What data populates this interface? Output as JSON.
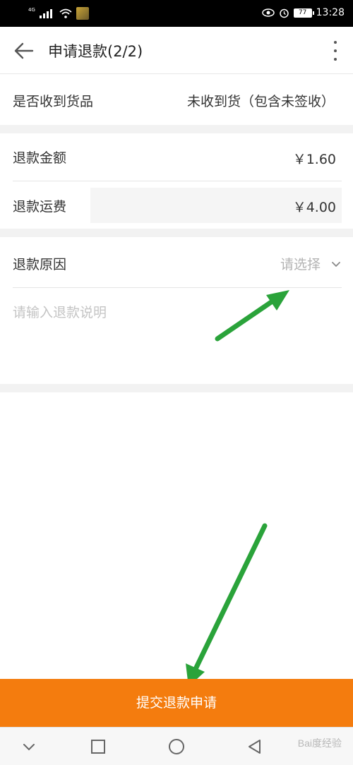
{
  "status_bar": {
    "network": "4G",
    "battery": "77",
    "time": "13:28"
  },
  "header": {
    "title": "申请退款(2/2)"
  },
  "goods_received": {
    "label": "是否收到货品",
    "value": "未收到货（包含未签收）"
  },
  "refund_amount": {
    "label": "退款金额",
    "value": "￥1.60"
  },
  "refund_shipping": {
    "label": "退款运费",
    "value": "￥4.00"
  },
  "refund_reason": {
    "label": "退款原因",
    "placeholder": "请选择"
  },
  "refund_explanation": {
    "placeholder": "请输入退款说明"
  },
  "submit": {
    "label": "提交退款申请"
  },
  "watermark": {
    "text": "Bai度经验"
  },
  "colors": {
    "accent": "#f47c0e",
    "annotation_arrow": "#2aa33a"
  },
  "icons": [
    "back-arrow-icon",
    "more-vertical-icon",
    "chevron-down-icon",
    "nav-back-icon",
    "nav-home-icon",
    "nav-recents-icon",
    "nav-collapse-icon"
  ]
}
